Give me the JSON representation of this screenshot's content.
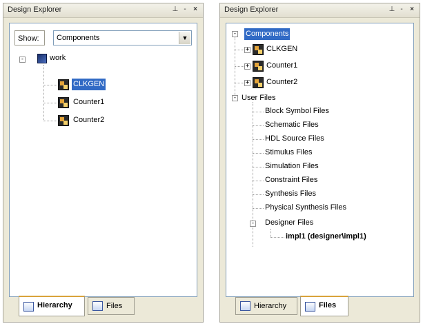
{
  "left_panel": {
    "title": "Design Explorer",
    "controls": {
      "pin": "⊥",
      "min": "-",
      "close": "×"
    },
    "show_label": "Show:",
    "show_value": "Components",
    "tree": {
      "root": "work",
      "children": [
        "CLKGEN",
        "Counter1",
        "Counter2"
      ]
    },
    "tabs": [
      "Hierarchy",
      "Files"
    ]
  },
  "right_panel": {
    "title": "Design Explorer",
    "controls": {
      "pin": "⊥",
      "min": "-",
      "close": "×"
    },
    "tree": {
      "components_label": "Components",
      "components": [
        "CLKGEN",
        "Counter1",
        "Counter2"
      ],
      "user_files_label": "User Files",
      "user_files": [
        "Block Symbol Files",
        "Schematic Files",
        "HDL Source Files",
        "Stimulus Files",
        "Simulation Files",
        "Constraint Files",
        "Synthesis Files",
        "Physical Synthesis Files"
      ],
      "designer_files_label": "Designer Files",
      "designer_item": "impl1 (designer\\impl1)"
    },
    "tabs": [
      "Hierarchy",
      "Files"
    ]
  },
  "expander_glyphs": {
    "collapsed": "+",
    "expanded": "-"
  }
}
